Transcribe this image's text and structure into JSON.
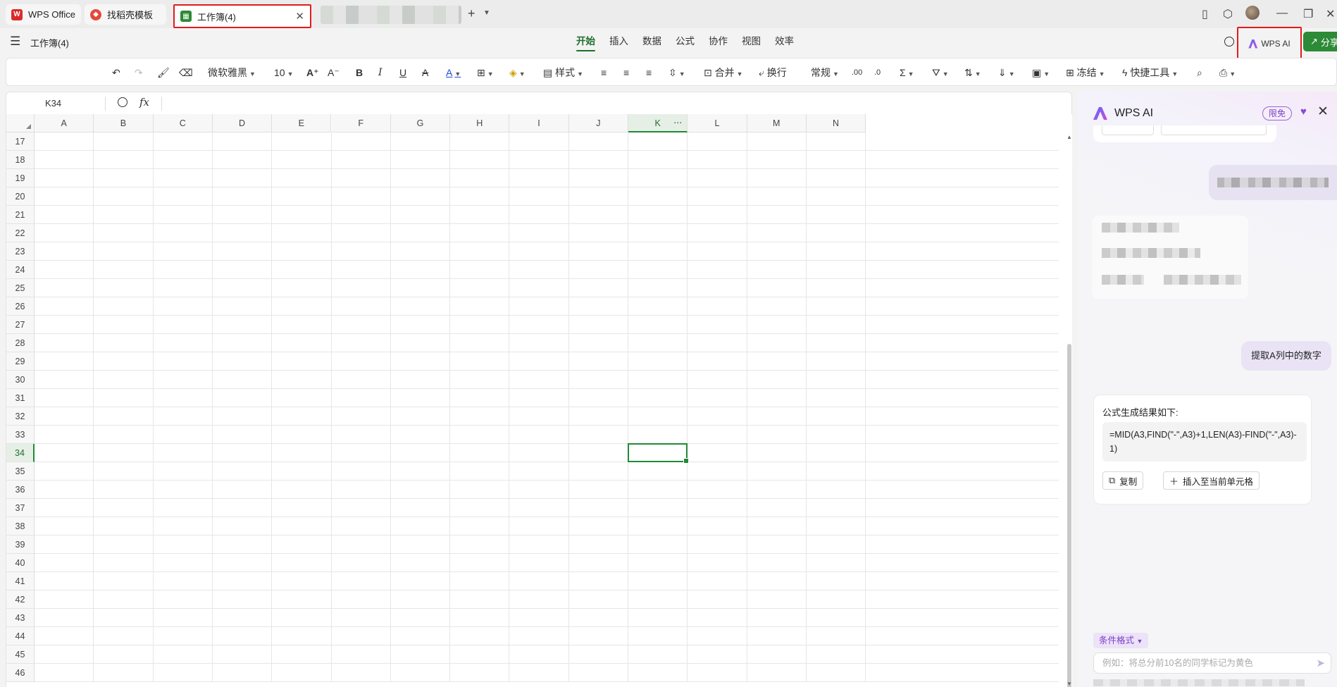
{
  "tabs": [
    {
      "label": "WPS Office",
      "icon": "wps-logo-icon",
      "color": "#d92b2b"
    },
    {
      "label": "找稻壳模板",
      "icon": "docer-icon",
      "color": "#e5483a"
    },
    {
      "label": "工作簿(4)",
      "icon": "spreadsheet-icon",
      "color": "#2d8a36",
      "active": true
    }
  ],
  "menubar": {
    "doc_title": "工作簿(4)",
    "tabs": [
      "开始",
      "插入",
      "数据",
      "公式",
      "协作",
      "视图",
      "效率"
    ],
    "active_tab": "开始",
    "wps_ai_label": "WPS AI",
    "share_label": "分享"
  },
  "toolbar": {
    "font_name": "微软雅黑",
    "font_size": "10",
    "style_label": "样式",
    "merge_label": "合并",
    "wrap_label": "换行",
    "number_format": "常规",
    "freeze_label": "冻结",
    "quick_tools_label": "快捷工具"
  },
  "formula_bar": {
    "name_box": "K34",
    "fx": "fx",
    "content": ""
  },
  "sheet": {
    "columns": [
      "A",
      "B",
      "C",
      "D",
      "E",
      "F",
      "G",
      "H",
      "I",
      "J",
      "K",
      "L",
      "M",
      "N"
    ],
    "rows": [
      17,
      18,
      19,
      20,
      21,
      22,
      23,
      24,
      25,
      26,
      27,
      28,
      29,
      30,
      31,
      32,
      33,
      34,
      35,
      36,
      37,
      38,
      39,
      40,
      41,
      42,
      43,
      44,
      45,
      46
    ],
    "active_cell": "K34",
    "active_column": "K",
    "active_row": 34,
    "accent": "#1f8a35"
  },
  "ai_panel": {
    "title": "WPS AI",
    "badge": "限免",
    "user_message": "提取A列中的数字",
    "result_title": "公式生成结果如下:",
    "formula": "=MID(A3,FIND(\"-\",A3)+1,LEN(A3)-FIND(\"-\",A3)-1)",
    "copy_label": "复制",
    "insert_label": "插入至当前单元格",
    "chip_label": "条件格式",
    "input_placeholder": "例如：将总分前10名的同学标记为黄色"
  }
}
